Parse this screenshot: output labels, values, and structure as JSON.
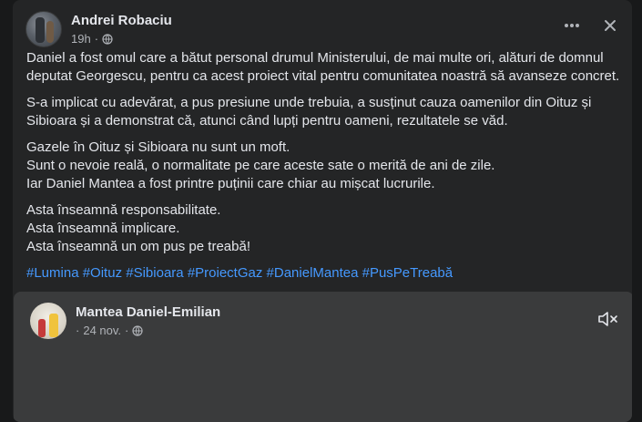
{
  "post": {
    "author": "Andrei Robaciu",
    "time": "19h",
    "separator": "·",
    "more_icon": "more-horizontal-icon",
    "close_icon": "close-icon",
    "paragraphs": [
      [
        "Daniel a fost omul care a bătut personal drumul Ministerului, de mai multe ori, alături de domnul",
        "deputat Georgescu, pentru ca acest proiect vital pentru comunitatea noastră să avanseze concret."
      ],
      [
        "S-a implicat cu adevărat, a pus presiune unde trebuia, a susținut cauza oamenilor din Oituz și",
        "Sibioara și a demonstrat că, atunci când lupți pentru oameni, rezultatele se văd."
      ],
      [
        "Gazele în Oituz și Sibioara nu sunt un moft.",
        "Sunt o nevoie reală, o normalitate pe care aceste sate o merită de ani de zile.",
        "Iar Daniel Mantea a fost printre puținii care chiar au mișcat lucrurile."
      ],
      [
        "Asta înseamnă responsabilitate.",
        "Asta înseamnă implicare.",
        "Asta înseamnă un om pus pe treabă!"
      ]
    ],
    "hashtags": [
      "#Lumina",
      "#Oituz",
      "#Sibioara",
      "#ProiectGaz",
      "#DanielMantea",
      "#PusPeTreabă"
    ]
  },
  "shared": {
    "author": "Mantea Daniel-Emilian",
    "date": "24 nov.",
    "separator": "·",
    "mute_icon": "volume-muted-icon"
  },
  "colors": {
    "background": "#18191a",
    "card": "#242526",
    "text": "#e4e6eb",
    "secondary": "#b0b3b8",
    "link": "#4599ff"
  }
}
